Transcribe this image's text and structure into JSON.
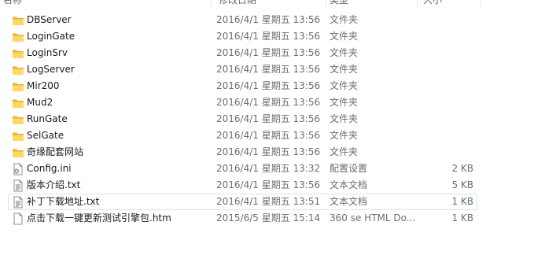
{
  "columns": {
    "name": "名称",
    "date": "修改日期",
    "type": "类型",
    "size": "大小"
  },
  "files": [
    {
      "name": "DBServer",
      "date": "2016/4/1 星期五 13:56",
      "type": "文件夹",
      "size": "",
      "icon": "folder-icon"
    },
    {
      "name": "LoginGate",
      "date": "2016/4/1 星期五 13:56",
      "type": "文件夹",
      "size": "",
      "icon": "folder-icon"
    },
    {
      "name": "LoginSrv",
      "date": "2016/4/1 星期五 13:56",
      "type": "文件夹",
      "size": "",
      "icon": "folder-icon"
    },
    {
      "name": "LogServer",
      "date": "2016/4/1 星期五 13:56",
      "type": "文件夹",
      "size": "",
      "icon": "folder-icon"
    },
    {
      "name": "Mir200",
      "date": "2016/4/1 星期五 13:56",
      "type": "文件夹",
      "size": "",
      "icon": "folder-icon"
    },
    {
      "name": "Mud2",
      "date": "2016/4/1 星期五 13:56",
      "type": "文件夹",
      "size": "",
      "icon": "folder-icon"
    },
    {
      "name": "RunGate",
      "date": "2016/4/1 星期五 13:56",
      "type": "文件夹",
      "size": "",
      "icon": "folder-icon"
    },
    {
      "name": "SelGate",
      "date": "2016/4/1 星期五 13:56",
      "type": "文件夹",
      "size": "",
      "icon": "folder-icon"
    },
    {
      "name": "奇缘配套网站",
      "date": "2016/4/1 星期五 13:56",
      "type": "文件夹",
      "size": "",
      "icon": "folder-icon"
    },
    {
      "name": "Config.ini",
      "date": "2016/4/1 星期五 13:32",
      "type": "配置设置",
      "size": "2 KB",
      "icon": "settings-file-icon"
    },
    {
      "name": "版本介绍.txt",
      "date": "2016/4/1 星期五 13:56",
      "type": "文本文档",
      "size": "5 KB",
      "icon": "text-file-icon"
    },
    {
      "name": "补丁下载地址.txt",
      "date": "2016/4/1 星期五 13:51",
      "type": "文本文档",
      "size": "1 KB",
      "icon": "text-file-icon",
      "hover": true
    },
    {
      "name": "点击下载一键更新测试引擎包.htm",
      "date": "2015/6/5 星期五 15:14",
      "type": "360 se HTML Do...",
      "size": "1 KB",
      "icon": "html-file-icon"
    }
  ]
}
